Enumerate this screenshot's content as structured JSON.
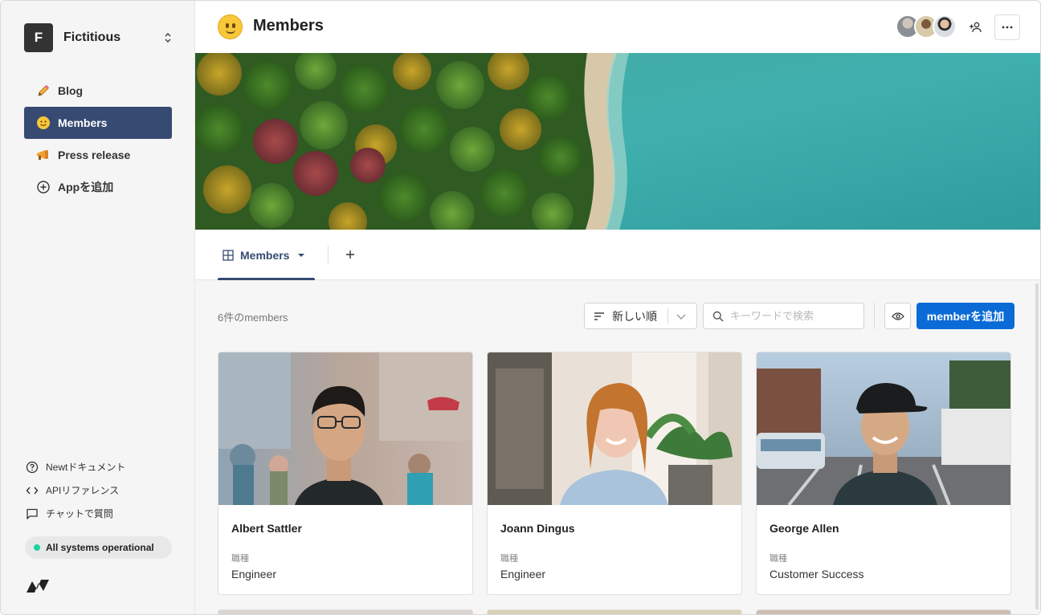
{
  "workspace": {
    "initial": "F",
    "name": "Fictitious"
  },
  "sidebar": {
    "items": [
      {
        "label": "Blog",
        "icon": "pencil-icon",
        "active": false
      },
      {
        "label": "Members",
        "icon": "smiley-icon",
        "active": true
      },
      {
        "label": "Press release",
        "icon": "megaphone-icon",
        "active": false
      },
      {
        "label": "Appを追加",
        "icon": "plus-circle-icon",
        "active": false
      }
    ],
    "footer_links": [
      {
        "label": "Newtドキュメント",
        "icon": "help-circle-icon"
      },
      {
        "label": "APIリファレンス",
        "icon": "code-icon"
      },
      {
        "label": "チャットで質問",
        "icon": "chat-icon"
      }
    ],
    "status": {
      "label": "All systems operational",
      "color": "#1dd1a1"
    }
  },
  "header": {
    "title": "Members"
  },
  "tabs": [
    {
      "label": "Members"
    }
  ],
  "toolbar": {
    "count": "6件のmembers",
    "sort_label": "新しい順",
    "search_placeholder": "キーワードで検索",
    "add_label": "memberを追加"
  },
  "cards": [
    {
      "name": "Albert Sattler",
      "field_label": "職種",
      "field_value": "Engineer"
    },
    {
      "name": "Joann Dingus",
      "field_label": "職種",
      "field_value": "Engineer"
    },
    {
      "name": "George Allen",
      "field_label": "職種",
      "field_value": "Customer Success"
    }
  ],
  "colors": {
    "accent": "#364a72",
    "primary_button": "#0a6bd6",
    "status_ok": "#1dd1a1"
  }
}
